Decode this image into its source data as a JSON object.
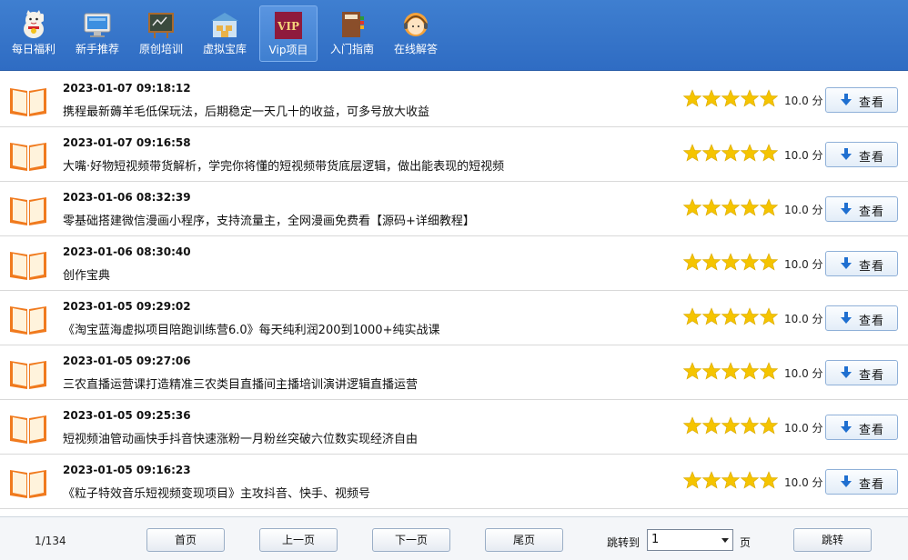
{
  "toolbar": {
    "items": [
      {
        "label": "每日福利",
        "icon": "lucky-cat-icon"
      },
      {
        "label": "新手推荐",
        "icon": "monitor-icon"
      },
      {
        "label": "原创培训",
        "icon": "blackboard-icon"
      },
      {
        "label": "虚拟宝库",
        "icon": "warehouse-icon"
      },
      {
        "label": "Vip项目",
        "icon": "vip-icon",
        "icon_text": "VIP",
        "active": true
      },
      {
        "label": "入门指南",
        "icon": "books-icon"
      },
      {
        "label": "在线解答",
        "icon": "support-agent-icon"
      }
    ]
  },
  "list": {
    "rows": [
      {
        "date": "2023-01-07 09:18:12",
        "title": "携程最新薅羊毛低保玩法，后期稳定一天几十的收益，可多号放大收益",
        "rating": 5,
        "score": "10.0 分",
        "button": "查看"
      },
      {
        "date": "2023-01-07 09:16:58",
        "title": "大嘴·好物短视频带货解析，学完你将懂的短视频带货底层逻辑，做出能表现的短视频",
        "rating": 5,
        "score": "10.0 分",
        "button": "查看"
      },
      {
        "date": "2023-01-06 08:32:39",
        "title": "零基础搭建微信漫画小程序，支持流量主，全网漫画免费看【源码+详细教程】",
        "rating": 5,
        "score": "10.0 分",
        "button": "查看"
      },
      {
        "date": "2023-01-06 08:30:40",
        "title": "创作宝典",
        "rating": 5,
        "score": "10.0 分",
        "button": "查看"
      },
      {
        "date": "2023-01-05 09:29:02",
        "title": "《淘宝蓝海虚拟项目陪跑训练营6.0》每天纯利润200到1000+纯实战课",
        "rating": 5,
        "score": "10.0 分",
        "button": "查看"
      },
      {
        "date": "2023-01-05 09:27:06",
        "title": "三农直播运营课打造精准三农类目直播间主播培训演讲逻辑直播运营",
        "rating": 5,
        "score": "10.0 分",
        "button": "查看"
      },
      {
        "date": "2023-01-05 09:25:36",
        "title": "短视频油管动画快手抖音快速涨粉一月粉丝突破六位数实现经济自由",
        "rating": 5,
        "score": "10.0 分",
        "button": "查看"
      },
      {
        "date": "2023-01-05 09:16:23",
        "title": "《粒子特效音乐短视频变现项目》主攻抖音、快手、视频号",
        "rating": 5,
        "score": "10.0 分",
        "button": "查看"
      }
    ]
  },
  "pager": {
    "info": "1/134",
    "first": "首页",
    "prev": "上一页",
    "next": "下一页",
    "last": "尾页",
    "jump_label": "跳转到",
    "jump_value": "1",
    "page_unit": "页",
    "go": "跳转"
  },
  "colors": {
    "toolbar_bg": "#3574c8",
    "star": "#f5c400",
    "book": "#f07a1e"
  }
}
